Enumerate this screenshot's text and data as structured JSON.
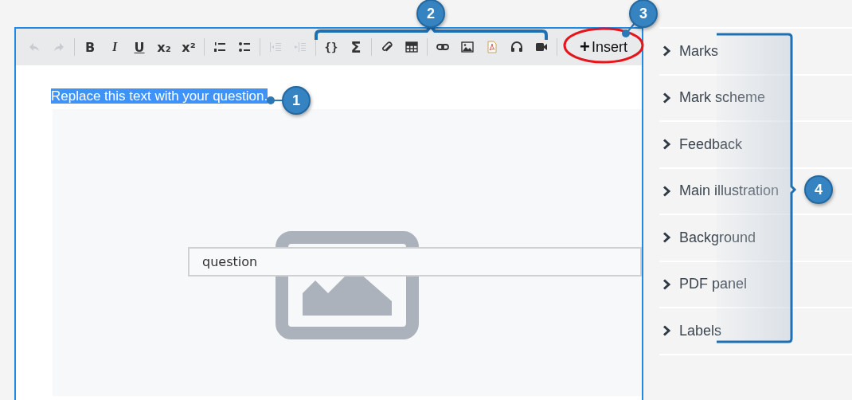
{
  "toolbar": {
    "groups": [
      [
        {
          "kind": "undo",
          "disabled": true
        },
        {
          "kind": "redo",
          "disabled": true
        }
      ],
      [
        {
          "kind": "bold",
          "glyph": "B",
          "disabled": false
        },
        {
          "kind": "italic",
          "glyph": "I",
          "disabled": false
        },
        {
          "kind": "underline",
          "glyph": "U",
          "disabled": false
        },
        {
          "kind": "subscript",
          "glyph": "x₂",
          "disabled": false
        },
        {
          "kind": "superscript",
          "glyph": "x²",
          "disabled": false
        }
      ],
      [
        {
          "kind": "ordered-list",
          "disabled": false
        },
        {
          "kind": "bullet-list",
          "disabled": false
        }
      ],
      [
        {
          "kind": "outdent",
          "disabled": true
        },
        {
          "kind": "indent",
          "disabled": true
        }
      ],
      [
        {
          "kind": "braces",
          "glyph": "{}",
          "disabled": false
        },
        {
          "kind": "sigma",
          "glyph": "Σ",
          "disabled": false
        }
      ],
      [
        {
          "kind": "attachment",
          "disabled": false
        },
        {
          "kind": "table",
          "disabled": false
        }
      ],
      [
        {
          "kind": "link",
          "disabled": false
        },
        {
          "kind": "image",
          "disabled": false
        },
        {
          "kind": "pdf",
          "disabled": false
        },
        {
          "kind": "audio",
          "disabled": false
        },
        {
          "kind": "video",
          "disabled": false
        }
      ]
    ],
    "insert_button": {
      "icon": "+",
      "label": "Insert",
      "circled": true
    }
  },
  "editor": {
    "question": {
      "text": "Replace this text with your question.",
      "selected": true
    },
    "answer_field": {
      "value": "question"
    }
  },
  "side_panel": {
    "items": [
      {
        "label": "Marks",
        "expanded": false
      },
      {
        "label": "Mark scheme",
        "expanded": false
      },
      {
        "label": "Feedback",
        "expanded": false
      },
      {
        "label": "Main illustration",
        "expanded": false
      },
      {
        "label": "Background",
        "expanded": false
      },
      {
        "label": "PDF panel",
        "expanded": false
      },
      {
        "label": "Labels",
        "expanded": false
      }
    ]
  },
  "callouts": [
    {
      "number": "1"
    },
    {
      "number": "2"
    },
    {
      "number": "3"
    },
    {
      "number": "4"
    }
  ]
}
